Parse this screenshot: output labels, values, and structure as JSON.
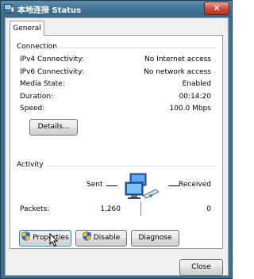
{
  "window": {
    "title": "本地连接 Status",
    "close_label": "✕"
  },
  "tabs": [
    {
      "label": "General"
    }
  ],
  "connection": {
    "heading": "Connection",
    "rows": [
      {
        "label": "IPv4 Connectivity:",
        "value": "No Internet access"
      },
      {
        "label": "IPv6 Connectivity:",
        "value": "No network access"
      },
      {
        "label": "Media State:",
        "value": "Enabled"
      },
      {
        "label": "Duration:",
        "value": "00:14:20"
      },
      {
        "label": "Speed:",
        "value": "100.0 Mbps"
      }
    ],
    "details_button": "Details..."
  },
  "activity": {
    "heading": "Activity",
    "sent_label": "Sent",
    "received_label": "Received",
    "packets_label": "Packets:",
    "packets_sent": "1,260",
    "packets_received": "0"
  },
  "buttons": {
    "properties": "Properties",
    "disable": "Disable",
    "diagnose": "Diagnose",
    "close": "Close"
  },
  "icons": {
    "title": "network-connection-icon",
    "shield": "uac-shield-icon",
    "activity": "network-computers-icon",
    "cursor": "mouse-pointer-icon"
  },
  "colors": {
    "titlebar": "#406f90",
    "close_button": "#c74a37",
    "focus_border": "#3c7fb1"
  }
}
